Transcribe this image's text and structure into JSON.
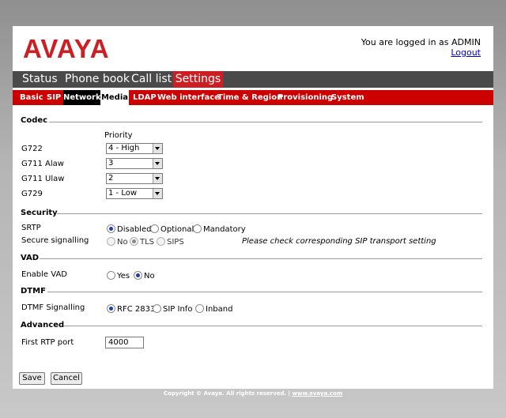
{
  "brand": {
    "logo_text": "AVAYA",
    "color": "#cc1f24"
  },
  "login": {
    "status": "You are logged in as ADMIN",
    "logout": "Logout"
  },
  "topnav": [
    "Status",
    "Phone book",
    "Call list",
    "Settings"
  ],
  "subnav": [
    "Basic",
    "SIP",
    "Network",
    "Media",
    "LDAP",
    "Web interface",
    "Time & Region",
    "Provisioning",
    "System"
  ],
  "codec": {
    "title": "Codec",
    "priority_header": "Priority",
    "rows": [
      {
        "label": "G722",
        "value": "4 - High"
      },
      {
        "label": "G711 Alaw",
        "value": "3"
      },
      {
        "label": "G711 Ulaw",
        "value": "2"
      },
      {
        "label": "G729",
        "value": "1 - Low"
      }
    ]
  },
  "security": {
    "title": "Security",
    "srtp_label": "SRTP",
    "srtp_options": [
      "Disabled",
      "Optional",
      "Mandatory"
    ],
    "srtp_selected": "Disabled",
    "sig_label": "Secure signalling",
    "sig_options": [
      "No",
      "TLS",
      "SIPS"
    ],
    "sig_selected": "TLS",
    "sig_note": "Please check corresponding SIP transport setting"
  },
  "vad": {
    "title": "VAD",
    "label": "Enable VAD",
    "options": [
      "Yes",
      "No"
    ],
    "selected": "No"
  },
  "dtmf": {
    "title": "DTMF",
    "label": "DTMF Signalling",
    "options": [
      "RFC 2833",
      "SIP Info",
      "Inband"
    ],
    "selected": "RFC 2833"
  },
  "advanced": {
    "title": "Advanced",
    "rtp_label": "First RTP port",
    "rtp_value": "4000"
  },
  "buttons": {
    "save": "Save",
    "cancel": "Cancel"
  },
  "footer": {
    "copyright": "Copyright © Avaya. All rights reserved.",
    "separator": "|",
    "link": "www.avaya.com"
  },
  "colors": {
    "accent": "#cc0000",
    "nav_dark": "#4a4a4a",
    "radio_selected": "#1a3fa0"
  }
}
